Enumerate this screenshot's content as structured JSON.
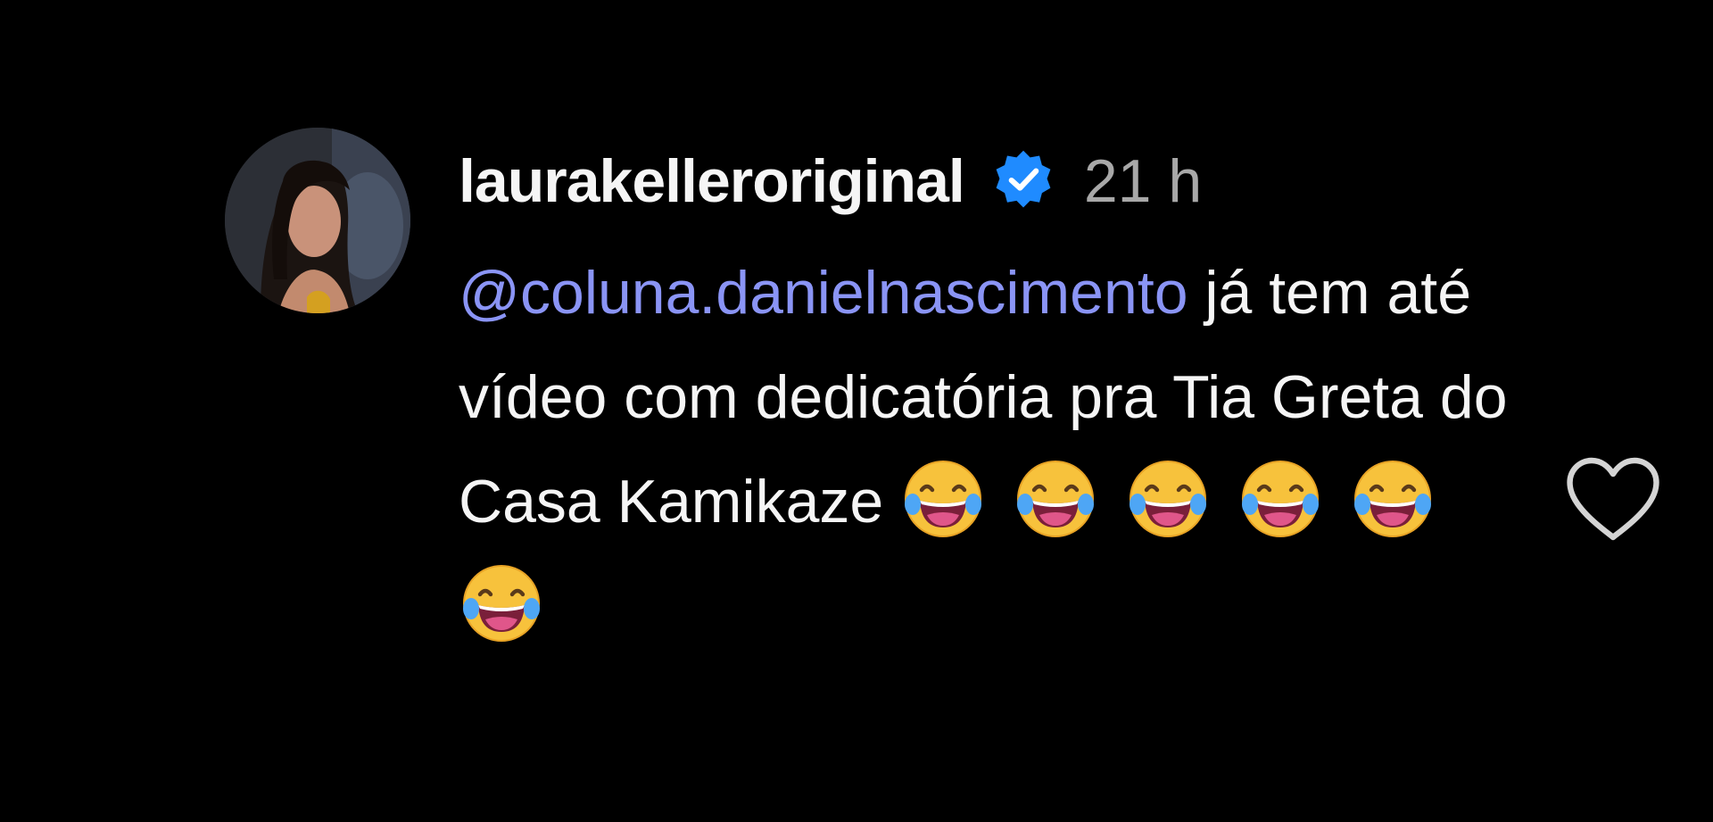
{
  "comment": {
    "username": "laurakelleroriginal",
    "verified": true,
    "time": "21 h",
    "mention": "@coluna.danielnascimento",
    "text_after_mention": " já tem até vídeo com dedicatória pra Tia Greta do Casa Kamikaze ",
    "emoji_count": 6,
    "emoji_name": "face-with-tears-of-joy"
  },
  "icons": {
    "verified": "verified-badge-icon",
    "like": "heart-icon"
  },
  "colors": {
    "background": "#000000",
    "text": "#f5f5f5",
    "muted": "#a8a8a8",
    "mention": "#8a94f5",
    "verified": "#1f8bff"
  }
}
